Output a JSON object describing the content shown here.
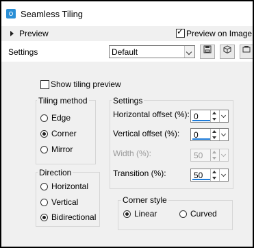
{
  "window": {
    "title": "Seamless Tiling"
  },
  "preview": {
    "label": "Preview",
    "preview_on_image_label": "Preview on Image",
    "preview_on_image_checked": true
  },
  "settings_bar": {
    "label": "Settings",
    "preset_value": "Default"
  },
  "show_tiling_preview": {
    "label": "Show tiling preview",
    "checked": false
  },
  "tiling_method": {
    "title": "Tiling method",
    "options": [
      {
        "label": "Edge",
        "selected": false
      },
      {
        "label": "Corner",
        "selected": true
      },
      {
        "label": "Mirror",
        "selected": false
      }
    ]
  },
  "settings_group": {
    "title": "Settings",
    "horizontal_offset": {
      "label": "Horizontal offset (%):",
      "value": "0"
    },
    "vertical_offset": {
      "label": "Vertical offset (%):",
      "value": "0"
    },
    "width": {
      "label": "Width (%):",
      "value": "50",
      "disabled": true
    },
    "transition": {
      "label": "Transition (%):",
      "value": "50"
    }
  },
  "direction": {
    "title": "Direction",
    "options": [
      {
        "label": "Horizontal",
        "selected": false
      },
      {
        "label": "Vertical",
        "selected": false
      },
      {
        "label": "Bidirectional",
        "selected": true
      }
    ]
  },
  "corner_style": {
    "title": "Corner style",
    "options": [
      {
        "label": "Linear",
        "selected": true
      },
      {
        "label": "Curved",
        "selected": false
      }
    ]
  },
  "icons": [
    "app-icon",
    "expand-triangle-icon",
    "save-preset-icon",
    "randomize-icon",
    "reset-icon",
    "dropdown-arrow-icon"
  ]
}
